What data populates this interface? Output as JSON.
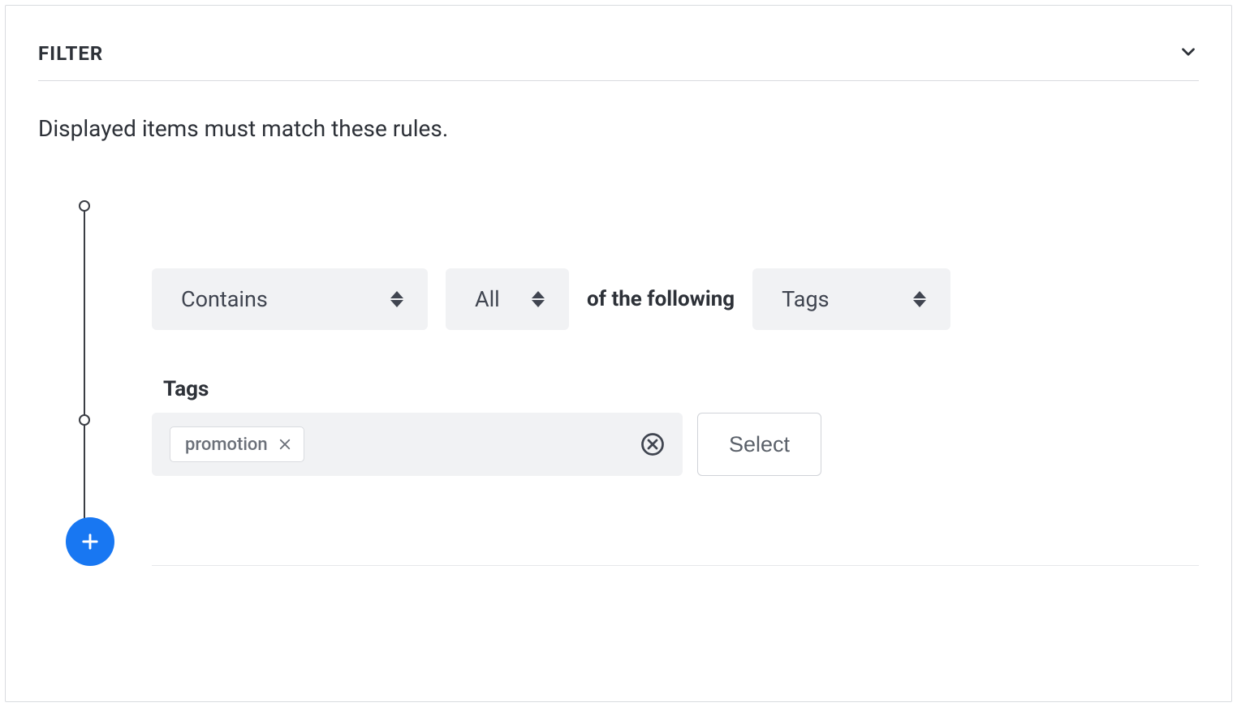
{
  "header": {
    "title": "FILTER"
  },
  "description": "Displayed items must match these rules.",
  "rule": {
    "operator_select": "Contains",
    "quantifier_select": "All",
    "middle_text": "of the following",
    "target_select": "Tags",
    "tags_label": "Tags",
    "chips": [
      {
        "label": "promotion"
      }
    ],
    "select_button": "Select"
  }
}
